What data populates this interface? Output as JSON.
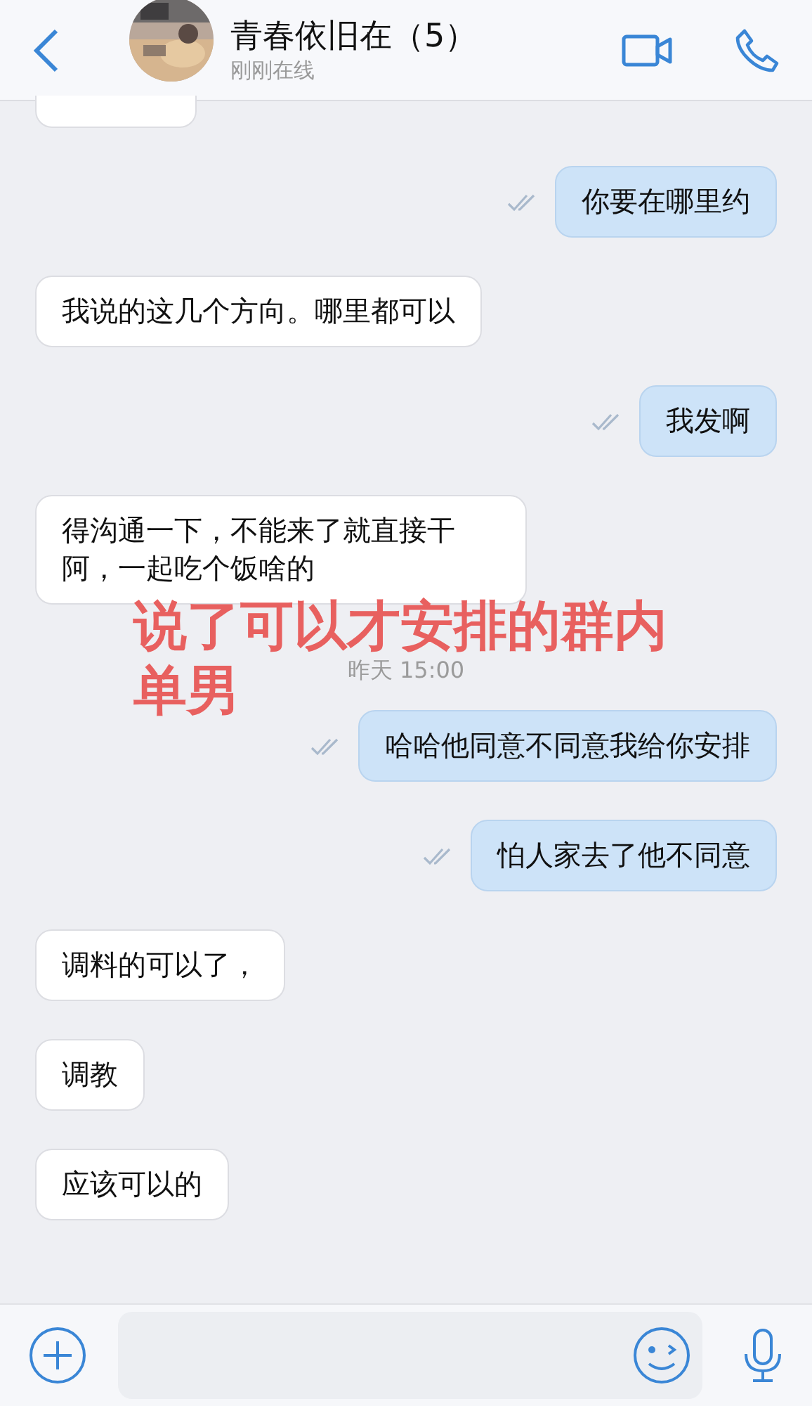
{
  "header": {
    "title": "青春依旧在（5）",
    "status": "刚刚在线"
  },
  "messages": [
    {
      "kind": "cut",
      "outgoing": false
    },
    {
      "kind": "text",
      "outgoing": true,
      "text": "你要在哪里约"
    },
    {
      "kind": "text",
      "outgoing": false,
      "text": "我说的这几个方向。哪里都可以"
    },
    {
      "kind": "text",
      "outgoing": true,
      "text": "我发啊"
    },
    {
      "kind": "text",
      "outgoing": false,
      "text": "得沟通一下，不能来了就直接干阿，一起吃个饭啥的"
    },
    {
      "kind": "time",
      "text": "昨天 15:00"
    },
    {
      "kind": "text",
      "outgoing": true,
      "text": "哈哈他同意不同意我给你安排"
    },
    {
      "kind": "text",
      "outgoing": true,
      "text": "怕人家去了他不同意"
    },
    {
      "kind": "text",
      "outgoing": false,
      "text": "调料的可以了，"
    },
    {
      "kind": "text",
      "outgoing": false,
      "text": "调教"
    },
    {
      "kind": "text",
      "outgoing": false,
      "text": "应该可以的"
    }
  ],
  "annotation_lines": [
    "说了可以才安排的群内",
    "单男"
  ]
}
